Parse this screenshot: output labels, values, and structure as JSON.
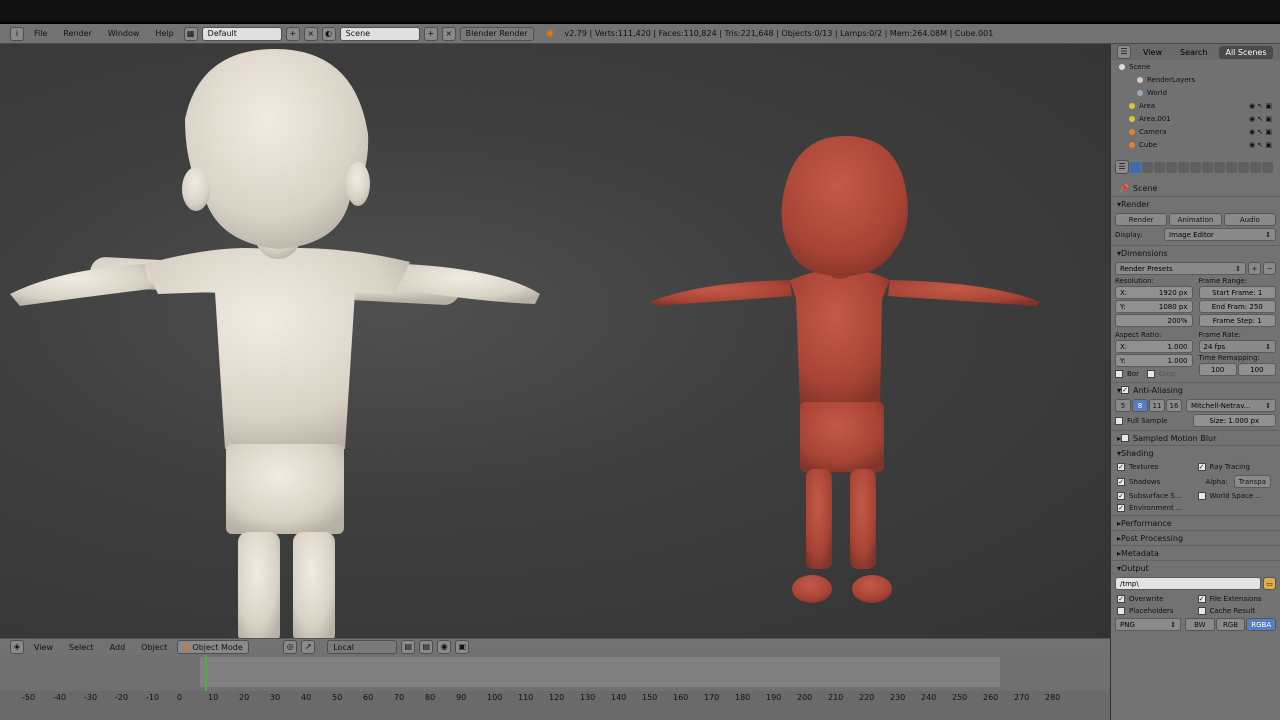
{
  "menus": [
    "File",
    "Render",
    "Window",
    "Help"
  ],
  "screen_layout": "Default",
  "scene": "Scene",
  "engine": "Blender Render",
  "stats": "v2.79 | Verts:111,420 | Faces:110,824 | Tris:221,648 | Objects:0/13 | Lamps:0/2 | Mem:264.08M | Cube.001",
  "viewport_header": {
    "menus": [
      "View",
      "Select",
      "Add",
      "Object"
    ],
    "mode": "Object Mode",
    "orientation": "Local"
  },
  "ruler_labels": [
    "-50",
    "-40",
    "-30",
    "-20",
    "-10",
    "0",
    "10",
    "20",
    "30",
    "40",
    "50",
    "60",
    "70",
    "80",
    "90",
    "100",
    "110",
    "120",
    "130",
    "140",
    "150",
    "160",
    "170",
    "180",
    "190",
    "200",
    "210",
    "220",
    "230",
    "240",
    "250",
    "260",
    "270",
    "280"
  ],
  "outliner": {
    "tabs": [
      "View",
      "Search",
      "All Scenes"
    ],
    "items": [
      "Scene",
      "RenderLayers",
      "World",
      "Area",
      "Area.001",
      "Camera",
      "Cube"
    ]
  },
  "properties": {
    "context": "Scene",
    "render": {
      "title": "Render",
      "buttons": [
        "Render",
        "Animation",
        "Audio"
      ],
      "display_label": "Display:",
      "display": "Image Editor"
    },
    "dimensions": {
      "title": "Dimensions",
      "presets": "Render Presets",
      "resolution_label": "Resolution:",
      "x": "1920 px",
      "y": "1080 px",
      "percent": "200%",
      "frame_range_label": "Frame Range:",
      "start": "Start Frame: 1",
      "end": "End Fram: 250",
      "step": "Frame Step: 1",
      "aspect_label": "Aspect Ratio:",
      "ax": "1.000",
      "ay": "1.000",
      "frame_rate_label": "Frame Rate:",
      "fps": "24 fps",
      "remap_label": "Time Remapping:",
      "remap_old": "100",
      "remap_new": "100",
      "border": "Bor",
      "crop": "Crop"
    },
    "aa": {
      "title": "Anti-Aliasing",
      "samples": [
        "5",
        "8",
        "11",
        "16"
      ],
      "filter": "Mitchell-Netrav...",
      "full_sample": "Full Sample",
      "size": "Size: 1.000 px"
    },
    "motion_blur": "Sampled Motion Blur",
    "shading": {
      "title": "Shading",
      "textures": "Textures",
      "ray_tracing": "Ray Tracing",
      "shadows": "Shadows",
      "alpha_label": "Alpha:",
      "alpha": "Transpa",
      "subsurface": "Subsurface S...",
      "world_space": "World Space ...",
      "environment": "Environment ..."
    },
    "performance": "Performance",
    "post": "Post Processing",
    "metadata": "Metadata",
    "output": {
      "title": "Output",
      "path": "/tmp\\",
      "overwrite": "Overwrite",
      "file_ext": "File Extensions",
      "placeholders": "Placeholders",
      "cache": "Cache Result",
      "format": "PNG",
      "bw": "BW",
      "rgb": "RGB",
      "rgba": "RGBA"
    }
  },
  "colors": {
    "left_model": "#e7e0d5",
    "right_model": "#b24a3c",
    "viewport_bg": "#404040"
  }
}
